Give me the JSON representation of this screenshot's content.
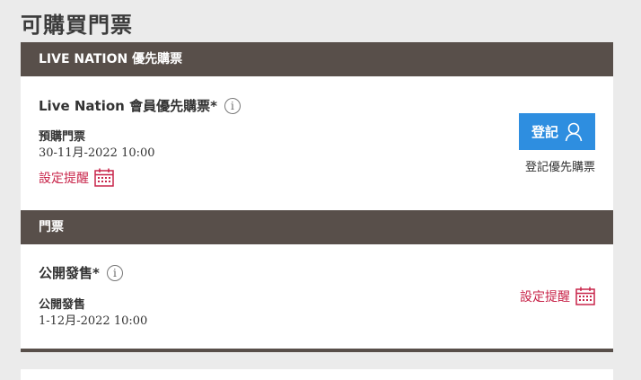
{
  "page": {
    "title": "可購買門票"
  },
  "presale": {
    "header": "LIVE NATION 優先購票",
    "event_title": "Live Nation 會員優先購票*",
    "info_icon": "info-icon",
    "sale_label": "預購門票",
    "sale_date": "30-11月-2022 10:00",
    "reminder_label": "設定提醒",
    "calendar_icon": "calendar-icon",
    "register_button_label": "登記",
    "user_icon": "user-icon",
    "register_caption": "登記優先購票",
    "accent_color": "#2e8ee0"
  },
  "tickets": {
    "header": "門票",
    "event_title": "公開發售*",
    "info_icon": "info-icon",
    "sale_label": "公開發售",
    "sale_date": "1-12月-2022 10:00",
    "reminder_label": "設定提醒",
    "calendar_icon": "calendar-icon"
  },
  "colors": {
    "header_bg": "#584f4a",
    "reminder": "#c8254a",
    "page_bg": "#ebebeb"
  }
}
